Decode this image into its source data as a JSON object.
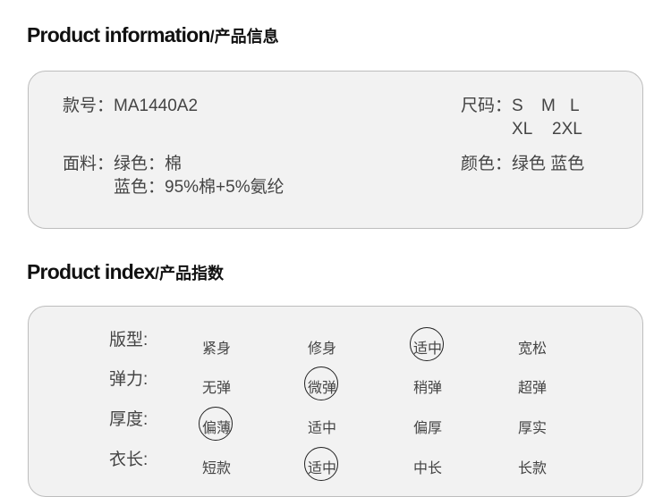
{
  "product_information": {
    "title": "Product information",
    "title_cn": "/产品信息",
    "style_no_label": "款号：",
    "style_no": "MA1440A2",
    "size_label": "尺码：",
    "sizes_row1": [
      "S",
      "M",
      "L"
    ],
    "sizes_row2": [
      "XL",
      "2XL"
    ],
    "fabric_label": "面料：",
    "fabric_lines": [
      {
        "color": "绿色：",
        "material": "棉"
      },
      {
        "color": "蓝色：",
        "material": "95%棉+5%氨纶"
      }
    ],
    "color_label": "颜色：",
    "colors": "绿色 蓝色"
  },
  "product_index": {
    "title": "Product index",
    "title_cn": "/产品指数",
    "rows": [
      {
        "label": "版型:",
        "options": [
          "紧身",
          "修身",
          "适中",
          "宽松"
        ],
        "selected": 2
      },
      {
        "label": "弹力:",
        "options": [
          "无弹",
          "微弹",
          "稍弹",
          "超弹"
        ],
        "selected": 1
      },
      {
        "label": "厚度:",
        "options": [
          "偏薄",
          "适中",
          "偏厚",
          "厚实"
        ],
        "selected": 0
      },
      {
        "label": "衣长:",
        "options": [
          "短款",
          "适中",
          "中长",
          "长款"
        ],
        "selected": 1
      }
    ]
  },
  "colors": {
    "panel_bg": "#f2f2f2",
    "panel_border": "#bdbdbd",
    "title": "#111111",
    "text": "#444444",
    "circle": "#222222"
  }
}
